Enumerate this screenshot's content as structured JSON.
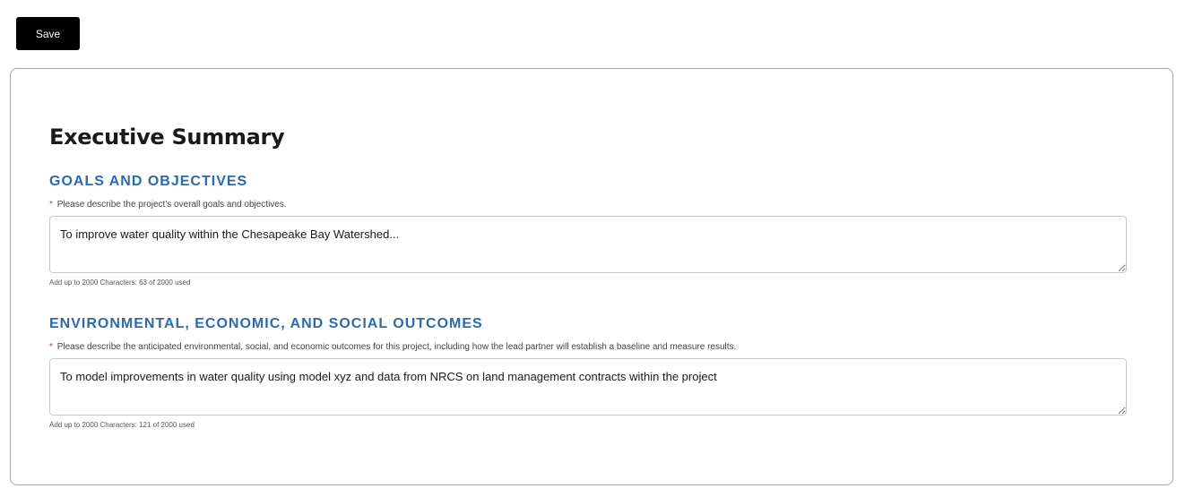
{
  "toolbar": {
    "save_label": "Save"
  },
  "page": {
    "title": "Executive Summary"
  },
  "sections": [
    {
      "heading": "GOALS AND OBJECTIVES",
      "required_marker": "*",
      "question": "Please describe the project's overall goals and objectives.",
      "value": "To improve water quality within the Chesapeake Bay Watershed...",
      "counter": "Add up to 2000 Characters: 63 of 2000 used"
    },
    {
      "heading": "ENVIRONMENTAL, ECONOMIC, AND SOCIAL OUTCOMES",
      "required_marker": "*",
      "question": "Please describe the anticipated environmental, social, and economic outcomes for this project, including how the lead partner will establish a baseline and measure results.",
      "value": "To model improvements in water quality using model xyz and data from NRCS on land management contracts within the project",
      "counter": "Add up to 2000 Characters: 121 of 2000 used"
    }
  ],
  "colors": {
    "heading": "#2c6aa8",
    "required": "#d0312d",
    "save_button": "#000000"
  }
}
